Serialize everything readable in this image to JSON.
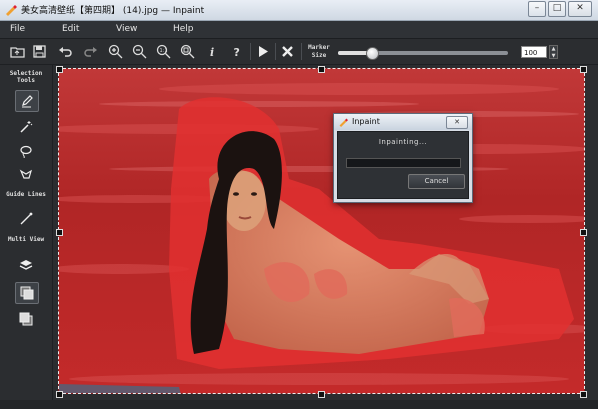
{
  "window": {
    "title": "美女高清壁纸【第四期】 (14).jpg — Inpaint",
    "minimize": "–",
    "maximize": "□",
    "close": "✕"
  },
  "menu": [
    "File",
    "Edit",
    "View",
    "Help"
  ],
  "toolbar": {
    "icons": [
      "open-icon",
      "save-icon",
      "undo-icon",
      "redo-icon",
      "zoom-in-icon",
      "zoom-out-icon",
      "zoom-actual-icon",
      "zoom-fit-icon",
      "info-icon",
      "help-icon",
      "run-icon",
      "cancel-icon"
    ],
    "marker_label": "Marker Size",
    "marker_size_value": "100",
    "marker_slider_fraction": 0.2
  },
  "left_panel": {
    "selection_label": "Selection Tools",
    "guide_label": "Guide Lines",
    "multi_label": "Multi View",
    "tools": [
      "marker-icon",
      "magic-wand-icon",
      "lasso-icon",
      "polygon-lasso-icon",
      "guide-line-icon",
      "layers-icon",
      "multi-view-front-icon",
      "multi-view-back-icon"
    ]
  },
  "dialog": {
    "title": "Inpaint",
    "close": "✕",
    "status": "Inpainting...",
    "progress_fraction": 0.0,
    "cancel_label": "Cancel"
  },
  "colors": {
    "mask_red": "#e02a2a",
    "sea_red": "#b82424",
    "ui_dark": "#2b2d30"
  }
}
